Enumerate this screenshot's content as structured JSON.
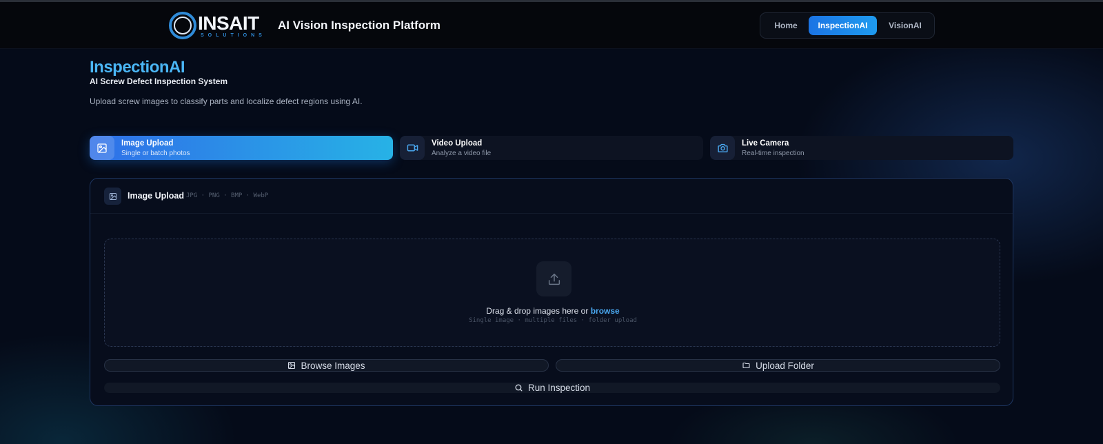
{
  "header": {
    "logo_word": "INSAIT",
    "logo_sub": "SOLUTIONS",
    "app_title": "AI Vision Inspection Platform",
    "nav": [
      {
        "label": "Home",
        "active": false
      },
      {
        "label": "InspectionAI",
        "active": true
      },
      {
        "label": "VisionAI",
        "active": false
      }
    ]
  },
  "hero": {
    "title": "InspectionAI",
    "subtitle": "AI Screw Defect Inspection System",
    "description": "Upload screw images to classify parts and localize defect regions using AI."
  },
  "modes": [
    {
      "title": "Image Upload",
      "subtitle": "Single or batch photos",
      "icon": "image-icon",
      "active": true
    },
    {
      "title": "Video Upload",
      "subtitle": "Analyze a video file",
      "icon": "video-icon",
      "active": false
    },
    {
      "title": "Live Camera",
      "subtitle": "Real-time inspection",
      "icon": "camera-icon",
      "active": false
    }
  ],
  "panel": {
    "title": "Image Upload",
    "formats": "JPG · PNG · BMP · WebP",
    "drop_text": "Drag & drop images here or ",
    "drop_link": "browse",
    "drop_hint": "Single image · multiple files · folder upload",
    "browse_button": "Browse Images",
    "folder_button": "Upload Folder",
    "run_button": "Run Inspection"
  },
  "colors": {
    "accent": "#1e88ea",
    "accent_light": "#4ab6f5",
    "background": "#050b19"
  }
}
